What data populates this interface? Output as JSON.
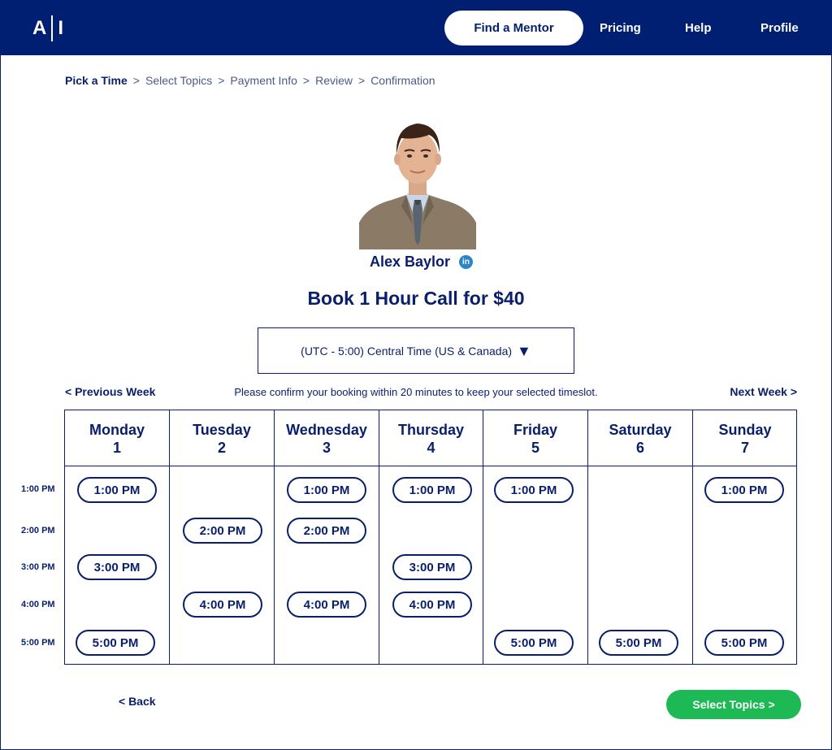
{
  "header": {
    "logo_left": "A",
    "logo_right": "I",
    "nav": {
      "find_mentor": "Find a Mentor",
      "pricing": "Pricing",
      "help": "Help",
      "profile": "Profile"
    }
  },
  "breadcrumb": {
    "steps": [
      "Pick a Time",
      "Select Topics",
      "Payment Info",
      "Review",
      "Confirmation"
    ],
    "separator": ">"
  },
  "mentor": {
    "name": "Alex Baylor",
    "linkedin_icon": "linkedin-icon",
    "linkedin_text": "in"
  },
  "booking": {
    "title": "Book 1 Hour Call for $40",
    "timezone": "(UTC - 5:00) Central Time (US & Canada)",
    "caret": "▼"
  },
  "week_nav": {
    "prev": "<  Previous Week",
    "next": "Next Week  >",
    "notice": "Please confirm your booking within 20 minutes to keep your selected timeslot."
  },
  "time_labels": [
    "1:00 PM",
    "2:00 PM",
    "3:00 PM",
    "4:00 PM",
    "5:00 PM"
  ],
  "days": [
    {
      "name": "Monday",
      "date": "1",
      "slots": [
        "1:00 PM",
        "3:00 PM",
        "5:00 PM"
      ]
    },
    {
      "name": "Tuesday",
      "date": "2",
      "slots": [
        "2:00 PM",
        "4:00 PM"
      ]
    },
    {
      "name": "Wednesday",
      "date": "3",
      "slots": [
        "1:00 PM",
        "2:00 PM",
        "4:00 PM"
      ]
    },
    {
      "name": "Thursday",
      "date": "4",
      "slots": [
        "1:00 PM",
        "3:00 PM",
        "4:00 PM"
      ]
    },
    {
      "name": "Friday",
      "date": "5",
      "slots": [
        "1:00 PM",
        "5:00 PM"
      ]
    },
    {
      "name": "Saturday",
      "date": "6",
      "slots": [
        "5:00 PM"
      ]
    },
    {
      "name": "Sunday",
      "date": "7",
      "slots": [
        "1:00 PM",
        "5:00 PM"
      ]
    }
  ],
  "footer": {
    "back": "<  Back",
    "next": "Select Topics  >"
  },
  "colors": {
    "navy": "#001f73",
    "green": "#1db954",
    "linkedin": "#2b86c6"
  }
}
